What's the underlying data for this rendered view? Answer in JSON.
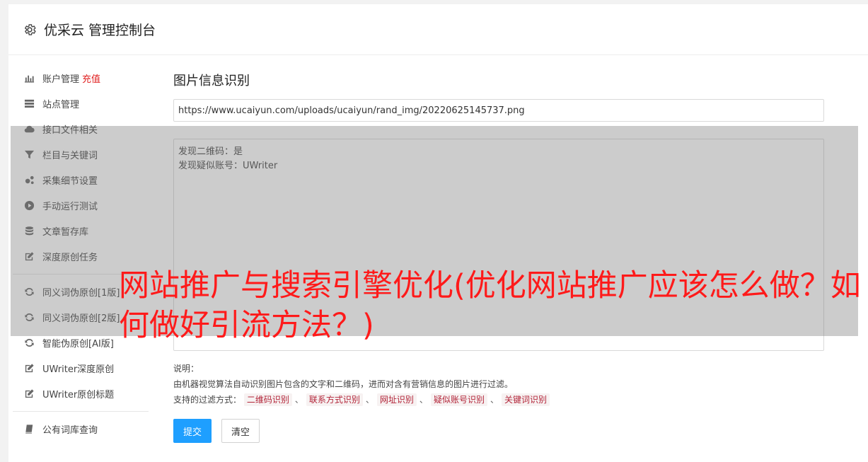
{
  "header": {
    "icon": "gear-icon",
    "title": "优采云 管理控制台"
  },
  "sidebar": {
    "items": [
      {
        "icon": "bar-chart-icon",
        "label": "账户管理",
        "extra": "充值"
      },
      {
        "icon": "server-icon",
        "label": "站点管理"
      },
      {
        "icon": "cloud-upload-icon",
        "label": "接口文件相关"
      },
      {
        "icon": "filter-icon",
        "label": "栏目与关键词"
      },
      {
        "icon": "cogs-icon",
        "label": "采集细节设置"
      },
      {
        "icon": "play-circle-icon",
        "label": "手动运行测试"
      },
      {
        "icon": "database-icon",
        "label": "文章暂存库"
      },
      {
        "icon": "edit-icon",
        "label": "深度原创任务"
      },
      {
        "icon": "refresh-icon",
        "label": "同义词伪原创[1版]"
      },
      {
        "icon": "refresh-icon",
        "label": "同义词伪原创[2版]"
      },
      {
        "icon": "refresh-icon",
        "label": "智能伪原创[AI版]"
      },
      {
        "icon": "edit-icon",
        "label": "UWriter深度原创"
      },
      {
        "icon": "edit-icon",
        "label": "UWriter原创标题"
      },
      {
        "icon": "book-icon",
        "label": "公有词库查询"
      }
    ]
  },
  "main": {
    "section_title": "图片信息识别",
    "url_value": "https://www.ucaiyun.com/uploads/ucaiyun/rand_img/20220625145737.png",
    "result_lines": [
      "发现二维码：是",
      "发现疑似账号：UWriter"
    ],
    "notes": {
      "label": "说明：",
      "desc": "由机器视觉算法自动识别图片包含的文字和二维码，进而对含有营销信息的图片进行过滤。",
      "filter_label": "支持的过滤方式：",
      "tags": [
        "二维码识别",
        "联系方式识别",
        "网址识别",
        "疑似账号识别",
        "关键词识别"
      ],
      "separator": "、"
    },
    "submit_label": "提交",
    "clear_label": "清空"
  },
  "overlay": {
    "title": "网站推广与搜索引擎优化(优化网站推广应该怎么做？如何做好引流方法？)"
  }
}
